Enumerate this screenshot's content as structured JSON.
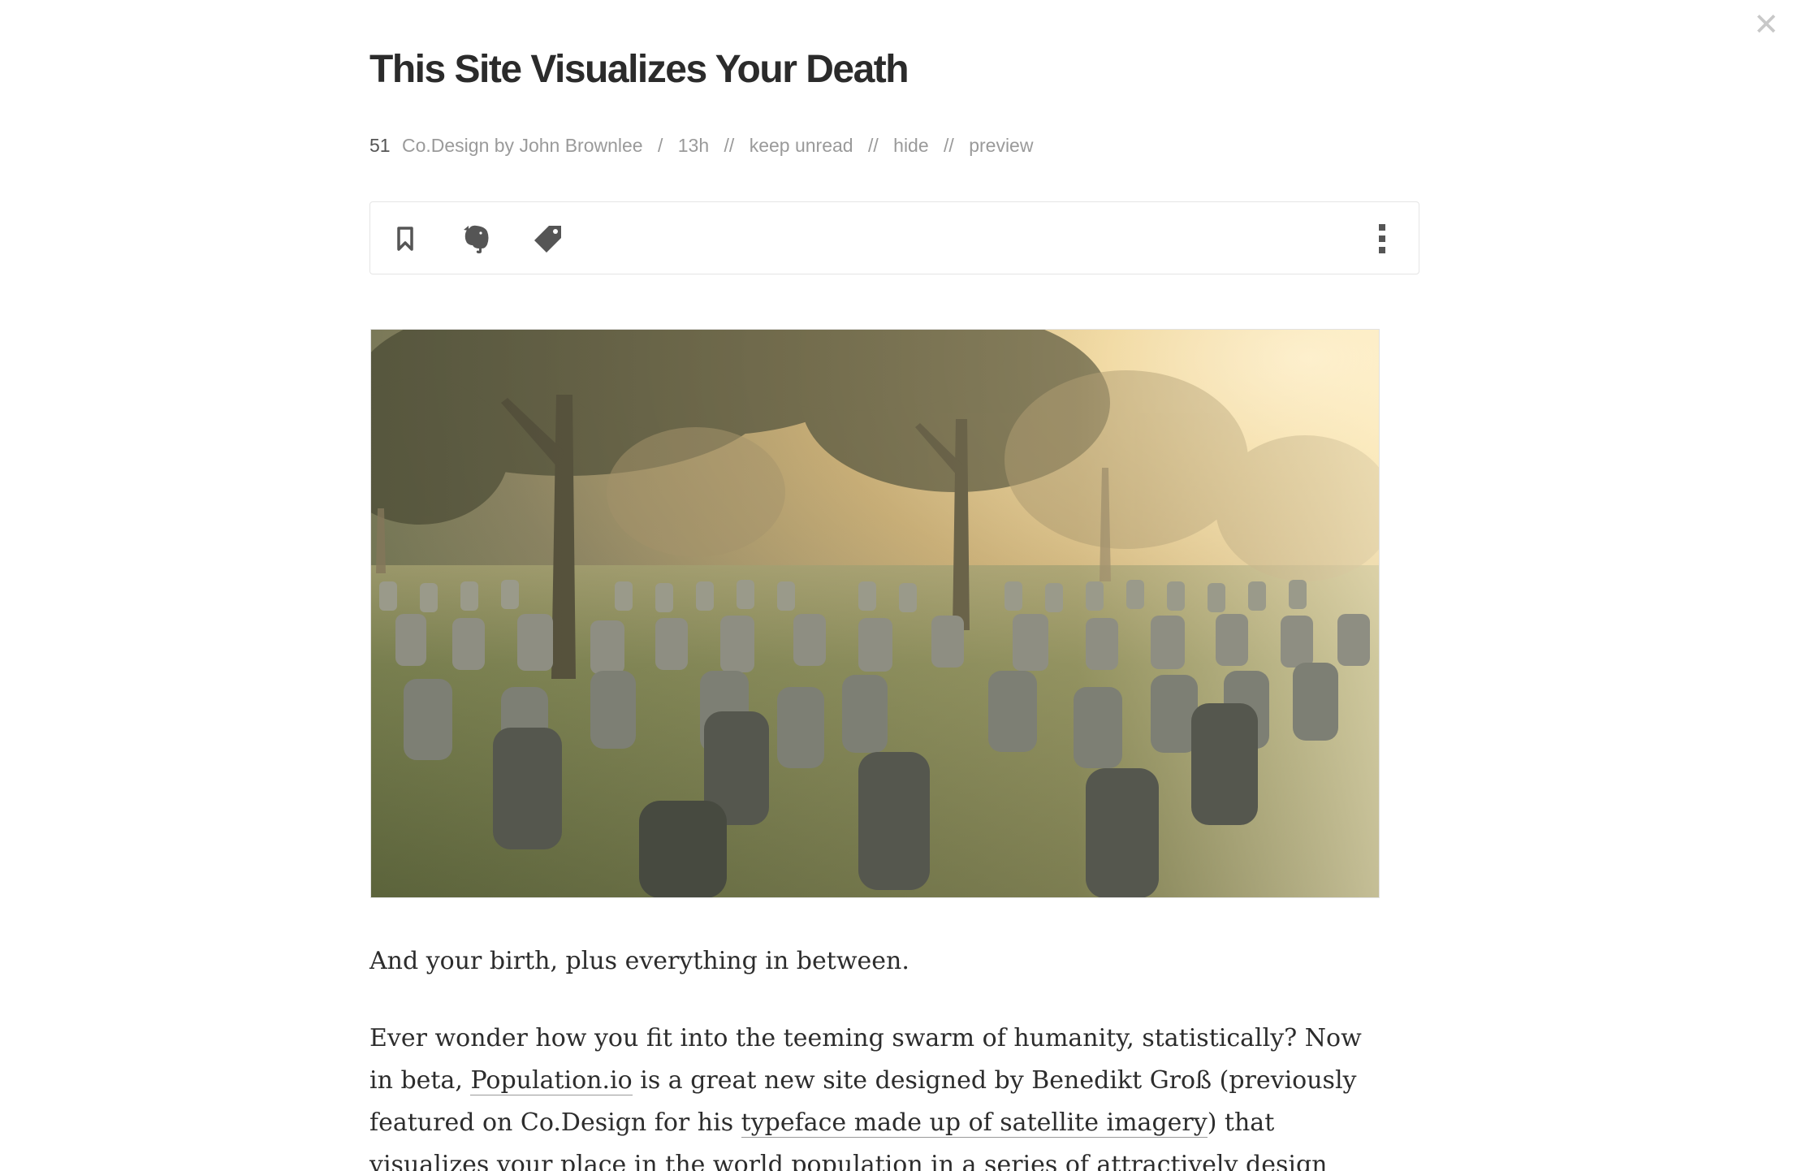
{
  "close": {
    "icon": "close-icon",
    "symbol": "✕"
  },
  "article": {
    "title": "This Site Visualizes Your Death",
    "meta": {
      "count": "51",
      "source": "Co.Design by John Brownlee",
      "sep1": "/",
      "age": "13h",
      "sep2": "//",
      "keep_unread": "keep unread",
      "sep3": "//",
      "hide": "hide",
      "sep4": "//",
      "preview": "preview"
    },
    "toolbar": {
      "icons": [
        "bookmark-icon",
        "evernote-elephant-icon",
        "tag-icon",
        "more-vertical-icon"
      ]
    },
    "hero_image": {
      "subject": "cemetery-with-trees-photo"
    },
    "lead": "And your birth, plus everything in between.",
    "para": {
      "t1": "Ever wonder how you fit into the teeming swarm of humanity, statistically? Now in beta, ",
      "link1": "Population.io",
      "t2": " is a great new site designed by Benedikt Groß (previously featured on Co.Design for his ",
      "link2": "typeface made up of satellite imagery",
      "t3": ") that visualizes your place in the world population in a series of attractively design tables and charts. That includes, rather"
    }
  },
  "colors": {
    "text": "#2c2c2c",
    "meta": "#9a9a9a",
    "icon": "#555555",
    "border": "#e5e5e5"
  }
}
